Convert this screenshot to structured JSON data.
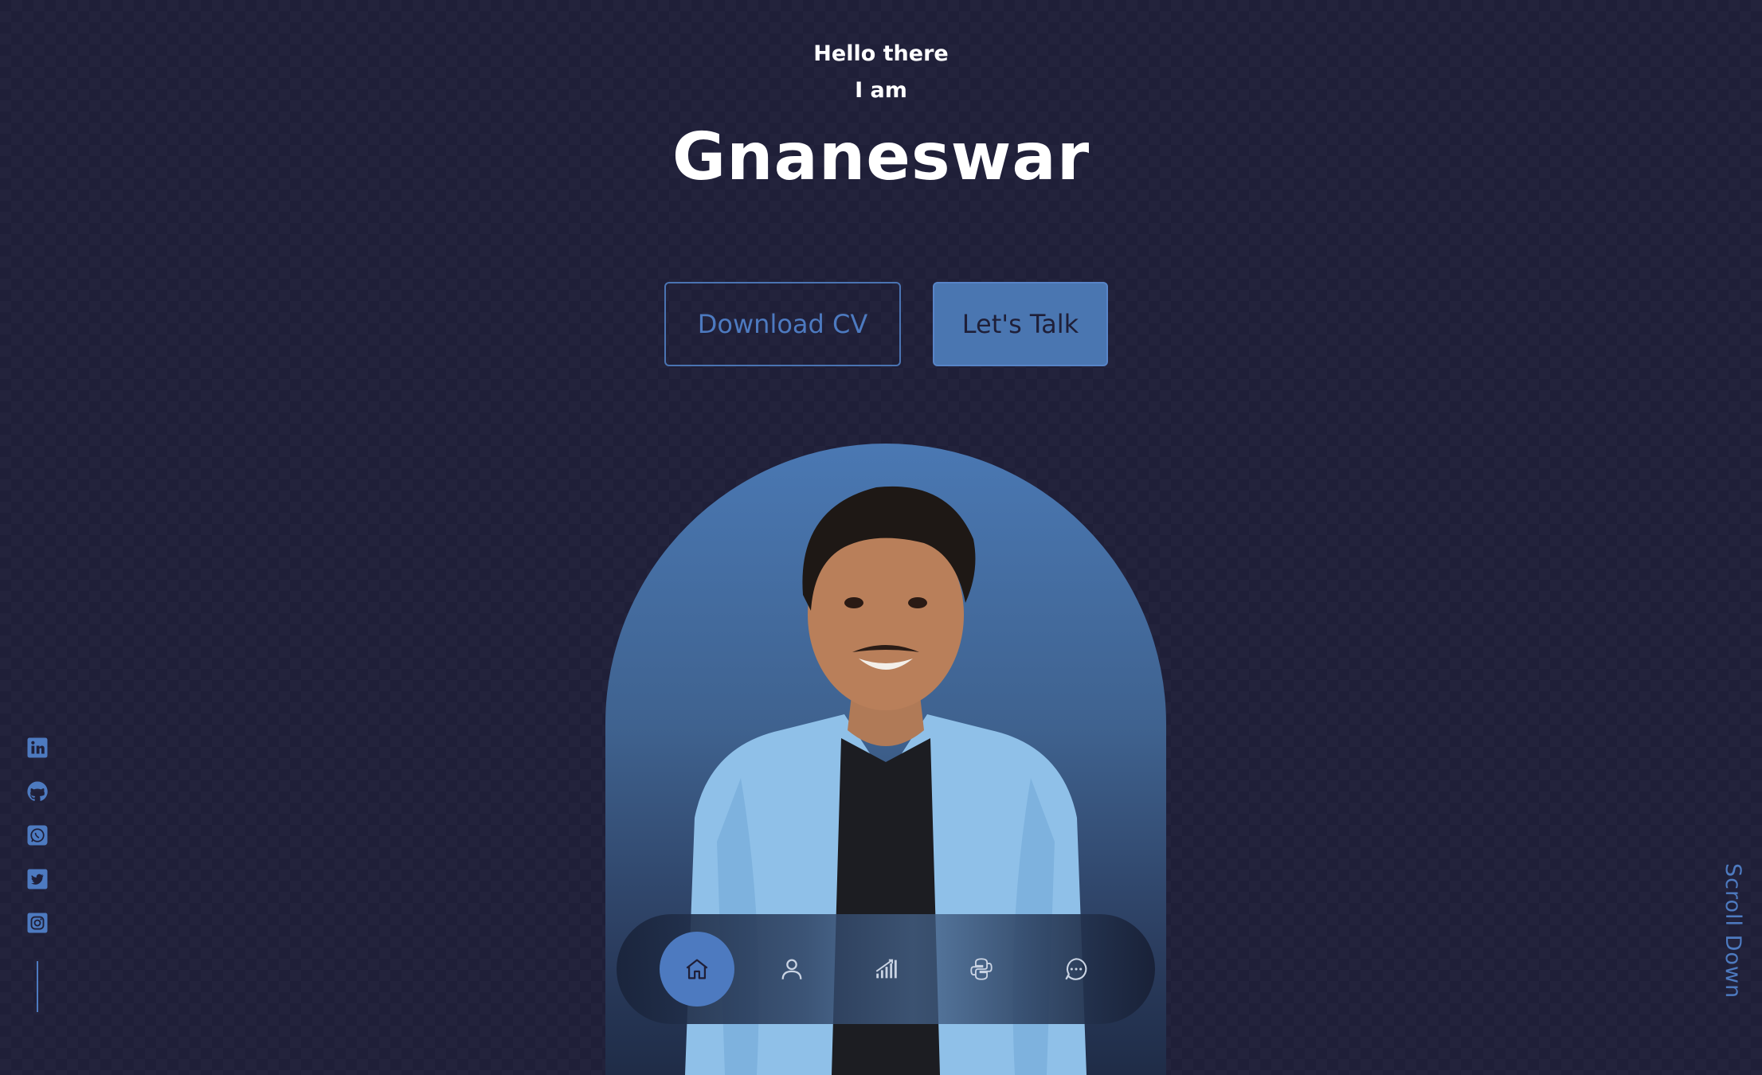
{
  "header": {
    "greeting": "Hello there",
    "intro": "I am",
    "name": "Gnaneswar"
  },
  "cta": {
    "download_label": "Download CV",
    "talk_label": "Let's Talk"
  },
  "nav": {
    "items": [
      {
        "icon": "home-icon",
        "active": true
      },
      {
        "icon": "user-icon",
        "active": false
      },
      {
        "icon": "chart-icon",
        "active": false
      },
      {
        "icon": "python-icon",
        "active": false
      },
      {
        "icon": "chat-icon",
        "active": false
      }
    ]
  },
  "socials": [
    "linkedin-icon",
    "github-icon",
    "whatsapp-icon",
    "twitter-icon",
    "instagram-icon"
  ],
  "scroll_label": "Scroll Down",
  "colors": {
    "background": "#1f1f38",
    "accent": "#4d7ac0",
    "text": "#ffffff"
  }
}
